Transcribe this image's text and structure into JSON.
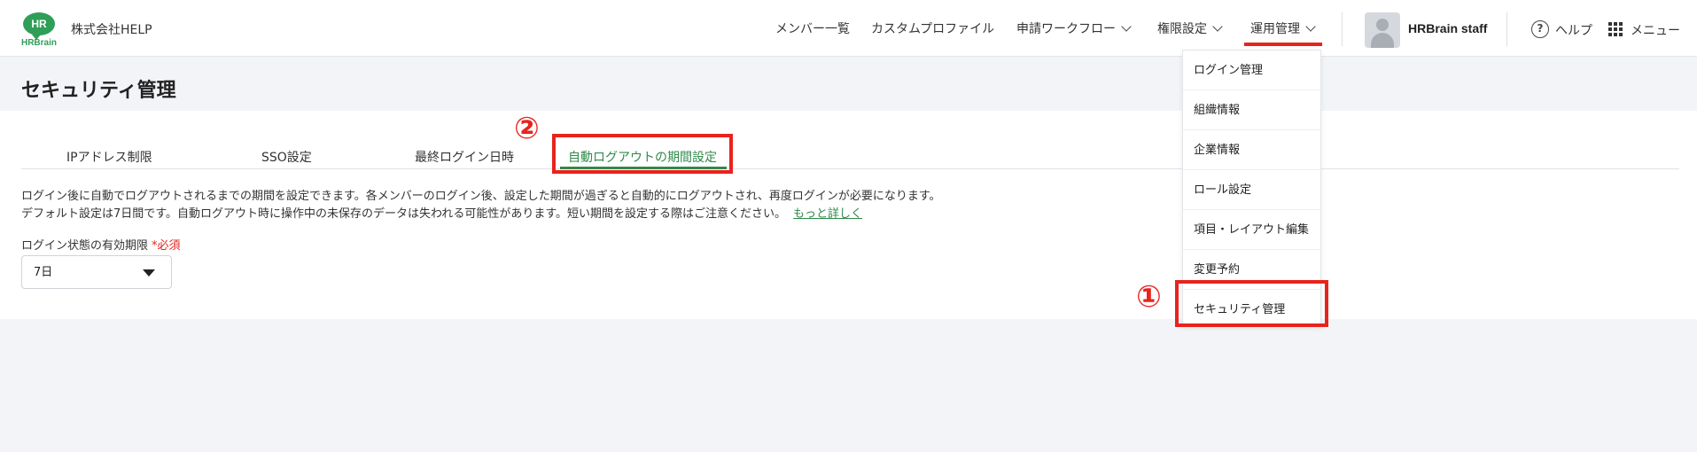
{
  "header": {
    "logo_text": "HR",
    "logo_word": "HRBrain",
    "company": "株式会社HELP",
    "nav": [
      {
        "label": "メンバー一覧"
      },
      {
        "label": "カスタムプロファイル"
      },
      {
        "label": "申請ワークフロー"
      },
      {
        "label": "権限設定"
      },
      {
        "label": "運用管理"
      }
    ],
    "user_name": "HRBrain staff",
    "help_label": "ヘルプ",
    "menu_label": "メニュー",
    "accent_color": "#e8231d",
    "brand_color": "#2f9e57"
  },
  "page": {
    "title": "セキュリティ管理",
    "tabs": [
      {
        "label": "IPアドレス制限"
      },
      {
        "label": "SSO設定"
      },
      {
        "label": "最終ログイン日時"
      },
      {
        "label": "自動ログアウトの期間設定"
      }
    ],
    "description_line1": "ログイン後に自動でログアウトされるまでの期間を設定できます。各メンバーのログイン後、設定した期間が過ぎると自動的にログアウトされ、再度ログインが必要になります。",
    "description_line2": "デフォルト設定は7日間です。自動ログアウト時に操作中の未保存のデータは失われる可能性があります。短い期間を設定する際はご注意ください。",
    "more_link": "もっと詳しく",
    "field_label": "ログイン状態の有効期限",
    "required_label": "*必須",
    "select_value": "7日"
  },
  "dropdown": {
    "items": [
      {
        "label": "ログイン管理"
      },
      {
        "label": "組織情報"
      },
      {
        "label": "企業情報"
      },
      {
        "label": "ロール設定"
      },
      {
        "label": "項目・レイアウト編集"
      },
      {
        "label": "変更予約"
      },
      {
        "label": "セキュリティ管理"
      }
    ]
  },
  "annotations": {
    "marker_1": "①",
    "marker_2": "②"
  }
}
